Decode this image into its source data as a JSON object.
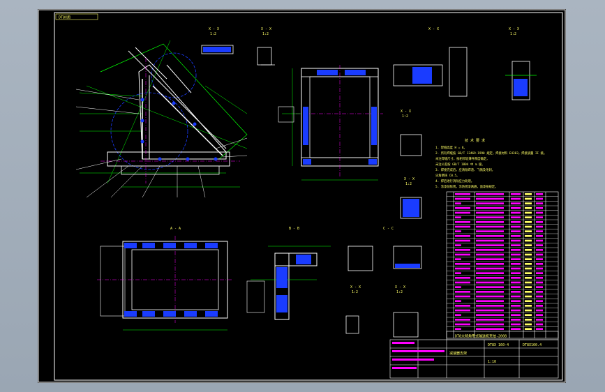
{
  "drawing": {
    "sheet_tag": "DT8X用",
    "main_title": "DT8大倾角带式输送机夹拍-2008",
    "title_block": {
      "line_a": "DT8X 160-4",
      "line_b": "DT8X160.4",
      "line_c": "减速器支架",
      "line_d": "1:10"
    }
  },
  "views": {
    "detail_labels": [
      "X - X",
      "X - X",
      "X - X",
      "X - X",
      "X - X",
      "X - X",
      "X - X",
      "X - X"
    ],
    "scale_labels": [
      "1:2",
      "1:2",
      "1:2",
      "1:2",
      "1:2",
      "1:2",
      "1:2",
      "1:2"
    ],
    "sections": [
      "A - A",
      "B - B",
      "C - C"
    ]
  },
  "notes": {
    "heading": "技 术 要 求",
    "items": [
      "1. 焊缝高度 H = 8。",
      "2. 所有焊缝按 GB/T 12469-1990 规定，焊接材料 E4303，焊接质量 II 级。",
      "   未注焊缝尺寸，按相邻较薄件厚度确定，",
      "   未注公差按 GB/T 1804 中 m 级。",
      "3. 焊接完成后，应清除焊渣、飞溅及毛刺，",
      "   尖角倒钝 C0.5。",
      "4. 焊后进行消除应力处理。",
      "5. 涂漆前除锈，涂防锈漆两遍，面漆按规定。"
    ]
  },
  "bom": {
    "row_count": 30
  },
  "colors": {
    "sheet": "#000000",
    "outline": "#ffffff",
    "dimension": "#00ff00",
    "center": "#ff00ff",
    "hidden": "#1a3cff",
    "text": "#ffff66",
    "section": "#ff3333"
  }
}
